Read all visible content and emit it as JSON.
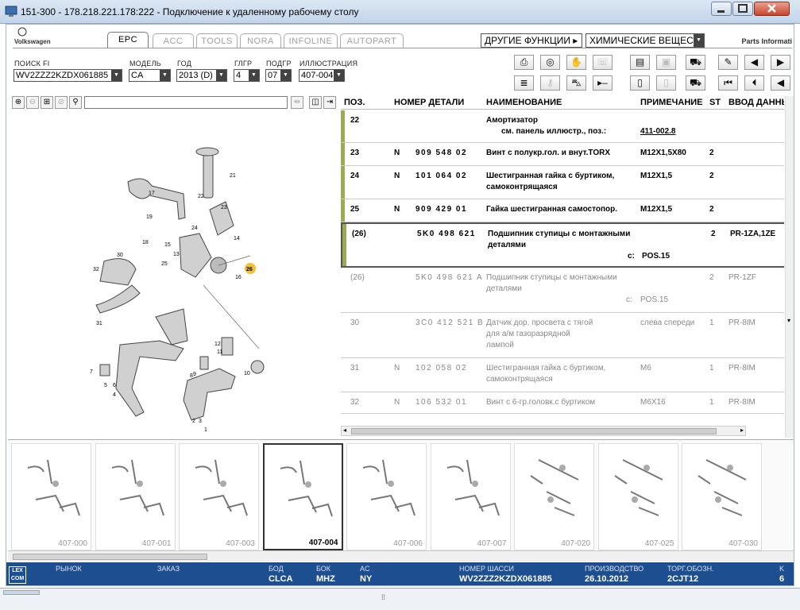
{
  "window": {
    "title": "151-300 - 178.218.221.178:222 - Подключение к удаленному рабочему столу"
  },
  "brand": {
    "left": "Volkswagen",
    "right": "Parts Informati"
  },
  "tabs": [
    "EPC",
    "ACC",
    "TOOLS",
    "NORA",
    "INFOLINE",
    "AUTOPART"
  ],
  "menus": {
    "other": "ДРУГИЕ ФУНКЦИИ",
    "chem": "ХИМИЧЕСКИЕ ВЕЩЕС"
  },
  "filters": {
    "vin": {
      "label": "ПОИСК FI",
      "value": "WV2ZZZ2KZDX061885"
    },
    "model": {
      "label": "МОДЕЛЬ",
      "value": "CA"
    },
    "year": {
      "label": "ГОД",
      "value": "2013 (D)"
    },
    "hg": {
      "label": "ГЛГР",
      "value": "4"
    },
    "ug": {
      "label": "ПОДГР",
      "value": "07"
    },
    "illus": {
      "label": "ИЛЛЮСТРАЦИЯ",
      "value": "407-004"
    }
  },
  "columns": [
    "ПОЗ.",
    "НОМЕР ДЕТАЛИ",
    "НАИМЕНОВАНИЕ",
    "ПРИМЕЧАНИЕ",
    "ST",
    "ВВОД ДАННЫ"
  ],
  "rows": [
    {
      "pos": "22",
      "n": "",
      "part": "",
      "name": [
        "Амортизатор",
        "см. панель иллюстр., поз.:"
      ],
      "note": "411-002.8",
      "st": "",
      "data": "",
      "grey": false
    },
    {
      "pos": "23",
      "n": "N",
      "part": "909 548 02",
      "name": [
        "Винт с полукр.гол. и внут.TORX"
      ],
      "note": "M12X1,5X80",
      "st": "2",
      "data": "",
      "grey": false
    },
    {
      "pos": "24",
      "n": "N",
      "part": "101 064 02",
      "name": [
        "Шестигранная гайка с буртиком,",
        "самоконтрящаяся"
      ],
      "note": "M12X1,5",
      "st": "2",
      "data": "",
      "grey": false
    },
    {
      "pos": "25",
      "n": "N",
      "part": "909 429 01",
      "name": [
        "Гайка шестигранная самостопор."
      ],
      "note": "M12X1,5",
      "st": "2",
      "data": "",
      "grey": false
    },
    {
      "pos": "(26)",
      "n": "",
      "part": "5K0 498 621",
      "name": [
        "Подшипник ступицы с монтажными",
        "деталями"
      ],
      "note_prefix": "с:",
      "note": "POS.15",
      "st": "2",
      "data": "PR-1ZA,1ZE",
      "grey": false
    },
    {
      "pos": "(26)",
      "n": "",
      "part": "5K0 498 621 A",
      "name": [
        "Подшипник ступицы с монтажными",
        "деталями"
      ],
      "note_prefix": "с:",
      "note": "POS.15",
      "st": "2",
      "data": "PR-1ZF",
      "grey": true
    },
    {
      "pos": "30",
      "n": "",
      "part": "3C0 412 521 B",
      "name": [
        "Датчик дор. просвета с тягой",
        "для а/м газоразрядной",
        "лампой"
      ],
      "note": "слева спереди",
      "st": "1",
      "data": "PR-8IM",
      "grey": true
    },
    {
      "pos": "31",
      "n": "N",
      "part": "102 058 02",
      "name": [
        "Шестигранная гайка с буртиком,",
        "самоконтрящаяся"
      ],
      "note": "M6",
      "st": "1",
      "data": "PR-8IM",
      "grey": true
    },
    {
      "pos": "32",
      "n": "N",
      "part": "106 532 01",
      "name": [
        "Винт с 6-гр.головк.с буртиком"
      ],
      "note": "M6X16",
      "st": "1",
      "data": "PR-8IM",
      "grey": true
    }
  ],
  "thumbs": [
    "407-000",
    "407-001",
    "407-003",
    "407-004",
    "407-006",
    "407-007",
    "407-020",
    "407-025",
    "407-030"
  ],
  "thumb_selected": "407-004",
  "callouts": [
    "21",
    "17",
    "22",
    "23",
    "24",
    "14",
    "19",
    "18",
    "15",
    "13",
    "25",
    "26",
    "16",
    "30",
    "32",
    "31",
    "11",
    "12",
    "9",
    "10",
    "8",
    "7",
    "6",
    "5",
    "4",
    "3",
    "2",
    "1"
  ],
  "status": [
    {
      "label": "РЫНОК",
      "value": ""
    },
    {
      "label": "ЗАКАЗ",
      "value": ""
    },
    {
      "label": "БОД",
      "value": "CLCA"
    },
    {
      "label": "БОК",
      "value": "MHZ"
    },
    {
      "label": "AC",
      "value": "NY"
    },
    {
      "label": "НОМЕР ШАССИ",
      "value": "WV2ZZZ2KZDX061885"
    },
    {
      "label": "ПРОИЗВОДСТВО",
      "value": "26.10.2012"
    },
    {
      "label": "ТОРГ.ОБОЗН.",
      "value": "2CJT12"
    },
    {
      "label": "K",
      "value": "6"
    }
  ],
  "lexcom": "LEX COM"
}
